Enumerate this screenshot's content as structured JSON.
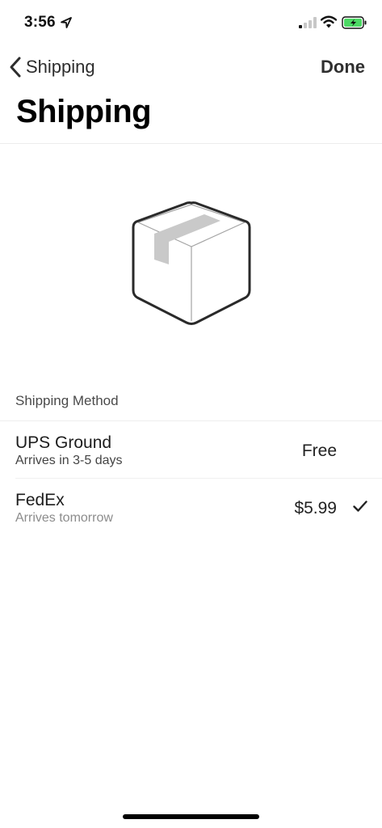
{
  "status_bar": {
    "time": "3:56",
    "icons": [
      "location-icon",
      "signal-icon",
      "wifi-icon",
      "battery-charging-icon"
    ],
    "battery_color": "#4cd964"
  },
  "nav": {
    "back_label": "Shipping",
    "done_label": "Done"
  },
  "page": {
    "title": "Shipping",
    "illustration": "package-box-icon"
  },
  "shipping_method": {
    "header": "Shipping Method",
    "options": [
      {
        "name": "UPS Ground",
        "subtitle": "Arrives in 3-5 days",
        "price": "Free",
        "selected": false
      },
      {
        "name": "FedEx",
        "subtitle": "Arrives tomorrow",
        "price": "$5.99",
        "selected": true
      }
    ]
  },
  "colors": {
    "text_primary": "#111111",
    "text_secondary": "#8c8c8c",
    "divider": "#ececec",
    "box_tape": "#c9c9c9"
  }
}
